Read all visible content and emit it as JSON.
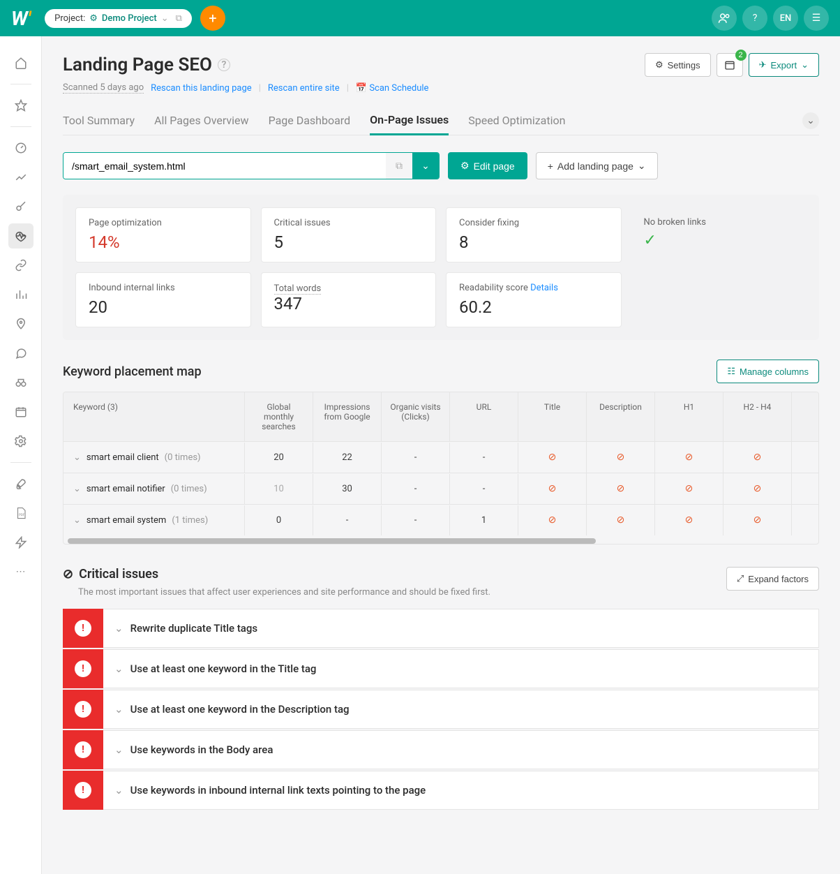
{
  "topbar": {
    "project_label": "Project:",
    "project_name": "Demo Project",
    "lang": "EN"
  },
  "page": {
    "title": "Landing Page SEO",
    "scanned": "Scanned 5 days ago",
    "rescan_page": "Rescan this landing page",
    "rescan_site": "Rescan entire site",
    "scan_schedule": "Scan Schedule",
    "settings": "Settings",
    "export": "Export",
    "calendar_badge": "2"
  },
  "tabs": {
    "items": [
      {
        "label": "Tool Summary"
      },
      {
        "label": "All Pages Overview"
      },
      {
        "label": "Page Dashboard"
      },
      {
        "label": "On-Page Issues"
      },
      {
        "label": "Speed Optimization"
      }
    ]
  },
  "url_row": {
    "url": "/smart_email_system.html",
    "edit": "Edit page",
    "add": "Add landing page"
  },
  "stats": {
    "opt_label": "Page optimization",
    "opt_value": "14%",
    "critical_label": "Critical issues",
    "critical_value": "5",
    "fix_label": "Consider fixing",
    "fix_value": "8",
    "broken_label": "No broken links",
    "inbound_label": "Inbound internal links",
    "inbound_value": "20",
    "words_label": "Total words",
    "words_value": "347",
    "read_label": "Readability score",
    "read_value": "60.2",
    "details": "Details"
  },
  "keyword_section": {
    "title": "Keyword placement map",
    "manage": "Manage columns",
    "headers": {
      "keyword": "Keyword (3)",
      "searches": "Global monthly searches",
      "impressions": "Impressions from Google",
      "clicks": "Organic visits (Clicks)",
      "url": "URL",
      "title": "Title",
      "desc": "Description",
      "h1": "H1",
      "h2": "H2 - H4"
    },
    "rows": [
      {
        "name": "smart email client",
        "times": "(0 times)",
        "searches": "20",
        "impressions": "22",
        "clicks": "-",
        "url": "-",
        "muted": false
      },
      {
        "name": "smart email notifier",
        "times": "(0 times)",
        "searches": "10",
        "impressions": "30",
        "clicks": "-",
        "url": "-",
        "muted": true
      },
      {
        "name": "smart email system",
        "times": "(1 times)",
        "searches": "0",
        "impressions": "-",
        "clicks": "-",
        "url": "1",
        "muted": false
      }
    ]
  },
  "critical": {
    "title": "Critical issues",
    "desc": "The most important issues that affect user experiences and site performance and should be fixed first.",
    "expand": "Expand factors",
    "items": [
      {
        "text": "Rewrite duplicate Title tags"
      },
      {
        "text": "Use at least one keyword in the Title tag"
      },
      {
        "text": "Use at least one keyword in the Description tag"
      },
      {
        "text": "Use keywords in the Body area"
      },
      {
        "text": "Use keywords in inbound internal link texts pointing to the page"
      }
    ]
  }
}
